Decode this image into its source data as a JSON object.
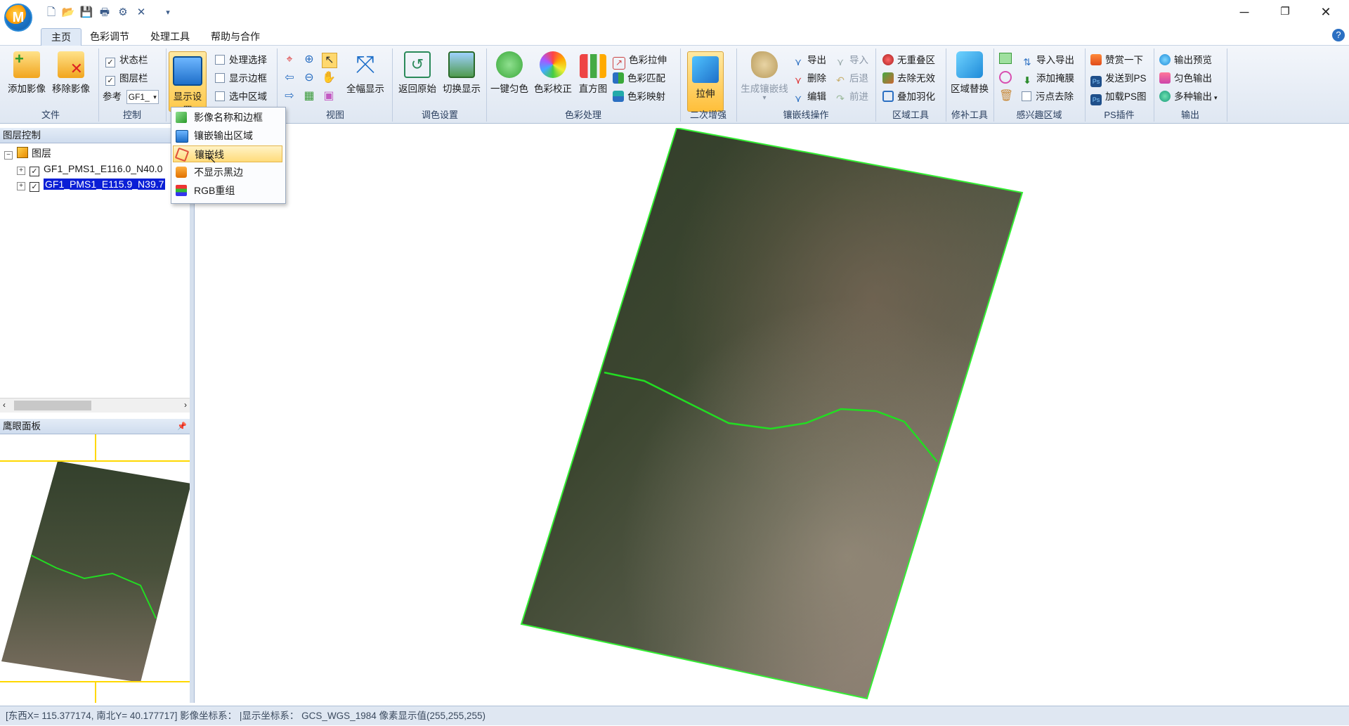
{
  "menu": {
    "tabs": [
      "主页",
      "色彩调节",
      "处理工具",
      "帮助与合作"
    ],
    "active_tab": "主页"
  },
  "ribbon": {
    "file": {
      "label": "文件",
      "add": "添加影像",
      "remove": "移除影像"
    },
    "control": {
      "label": "控制",
      "statusbar": "状态栏",
      "layerbar": "图层栏",
      "ref_label": "参考",
      "ref_value": "GF1_"
    },
    "display": {
      "label": "显示设置",
      "process_select": "处理选择",
      "show_border": "显示边框",
      "select_region": "选中区域"
    },
    "view": {
      "label": "视图",
      "full_display": "全幅显示"
    },
    "tone": {
      "label": "调色设置",
      "return_original": "返回原始",
      "switch_display": "切换显示"
    },
    "color": {
      "label": "色彩处理",
      "one_key": "一键匀色",
      "correction": "色彩校正",
      "histogram": "直方图",
      "stretch": "色彩拉伸",
      "match": "色彩匹配",
      "mapping": "色彩映射"
    },
    "enhance": {
      "label": "二次增强",
      "stretch": "拉伸"
    },
    "seamline": {
      "label": "镶嵌线操作",
      "generate": "生成镶嵌线",
      "export": "导出",
      "import": "导入",
      "delete": "删除",
      "back": "后退",
      "edit": "编辑",
      "forward": "前进"
    },
    "region": {
      "label": "区域工具",
      "no_overlap": "无重叠区",
      "remove_invalid": "去除无效",
      "feather": "叠加羽化"
    },
    "repair": {
      "label": "修补工具",
      "replace": "区域替换"
    },
    "roi": {
      "label": "感兴趣区域",
      "import_export": "导入导出",
      "add_mask": "添加掩膜",
      "remove_stain": "污点去除"
    },
    "ps": {
      "label": "PS插件",
      "praise": "赞赏一下",
      "send": "发送到PS",
      "load": "加载PS图"
    },
    "output": {
      "label": "输出",
      "preview": "输出预览",
      "uniform": "匀色输出",
      "multi": "多种输出"
    }
  },
  "dropdown": {
    "items": [
      "影像名称和边框",
      "镶嵌输出区域",
      "镶嵌线",
      "不显示黑边",
      "RGB重组"
    ],
    "hovered": "镶嵌线"
  },
  "layer_panel": {
    "title": "图层控制",
    "root": "图层",
    "layers": [
      "GF1_PMS1_E116.0_N40.0",
      "GF1_PMS1_E115.9_N39.7"
    ],
    "selected": "GF1_PMS1_E115.9_N39.7"
  },
  "eagle_panel": {
    "title": "鹰眼面板"
  },
  "statusbar": {
    "text": "[东西X= 115.377174, 南北Y= 40.177717] 影像坐标系： |显示坐标系： GCS_WGS_1984 像素显示值(255,255,255)"
  },
  "colors": {
    "seamline": "#22dd22",
    "footprint": "#33ee33",
    "eagle_view": "#ffd800",
    "accent": "#2b6fc2"
  }
}
